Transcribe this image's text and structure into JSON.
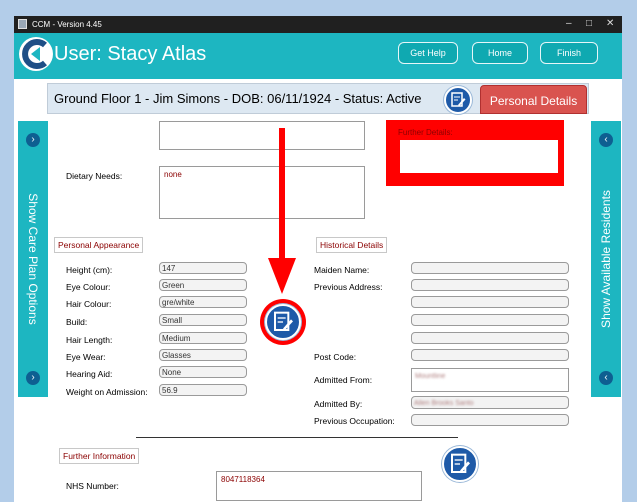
{
  "window": {
    "title": "CCM - Version 4.45",
    "controls": [
      "–",
      "□",
      "✕"
    ]
  },
  "header": {
    "user_title": "User: Stacy Atlas",
    "buttons": {
      "help": "Get Help",
      "home": "Home",
      "finish": "Finish"
    }
  },
  "banner": {
    "text": "Ground Floor 1 - Jim Simons - DOB: 06/11/1924 - Status: Active",
    "tab": "Personal Details"
  },
  "side": {
    "left": "Show Care Plan Options",
    "right": "Show Available Residents"
  },
  "further_details_label": "Further Details:",
  "dietary": {
    "label": "Dietary Needs:",
    "value": "none"
  },
  "appearance": {
    "title": "Personal Appearance",
    "fields": [
      {
        "label": "Height (cm):",
        "value": "147"
      },
      {
        "label": "Eye Colour:",
        "value": "Green"
      },
      {
        "label": "Hair Colour:",
        "value": "gre/white"
      },
      {
        "label": "Build:",
        "value": "Small"
      },
      {
        "label": "Hair Length:",
        "value": "Medium"
      },
      {
        "label": "Eye Wear:",
        "value": "Glasses"
      },
      {
        "label": "Hearing Aid:",
        "value": "None"
      },
      {
        "label": "Weight on Admission:",
        "value": "56.9"
      }
    ]
  },
  "historical": {
    "title": "Historical Details",
    "fields": [
      {
        "label": "Maiden Name:",
        "value": ""
      },
      {
        "label": "Previous Address:",
        "value": ""
      },
      {
        "label": "Post Code:",
        "value": ""
      },
      {
        "label": "Admitted From:",
        "value": "Mountline"
      },
      {
        "label": "Admitted By:",
        "value": "Allen Brooks Santo"
      },
      {
        "label": "Previous Occupation:",
        "value": ""
      }
    ]
  },
  "further_info": {
    "title": "Further Information",
    "nhs_label": "NHS Number:",
    "nhs_value": "8047118364"
  },
  "colors": {
    "accent": "#1db6c1",
    "highlight": "#ff0000",
    "tab": "#d9534f",
    "circle_button": "#1e5aa8"
  }
}
